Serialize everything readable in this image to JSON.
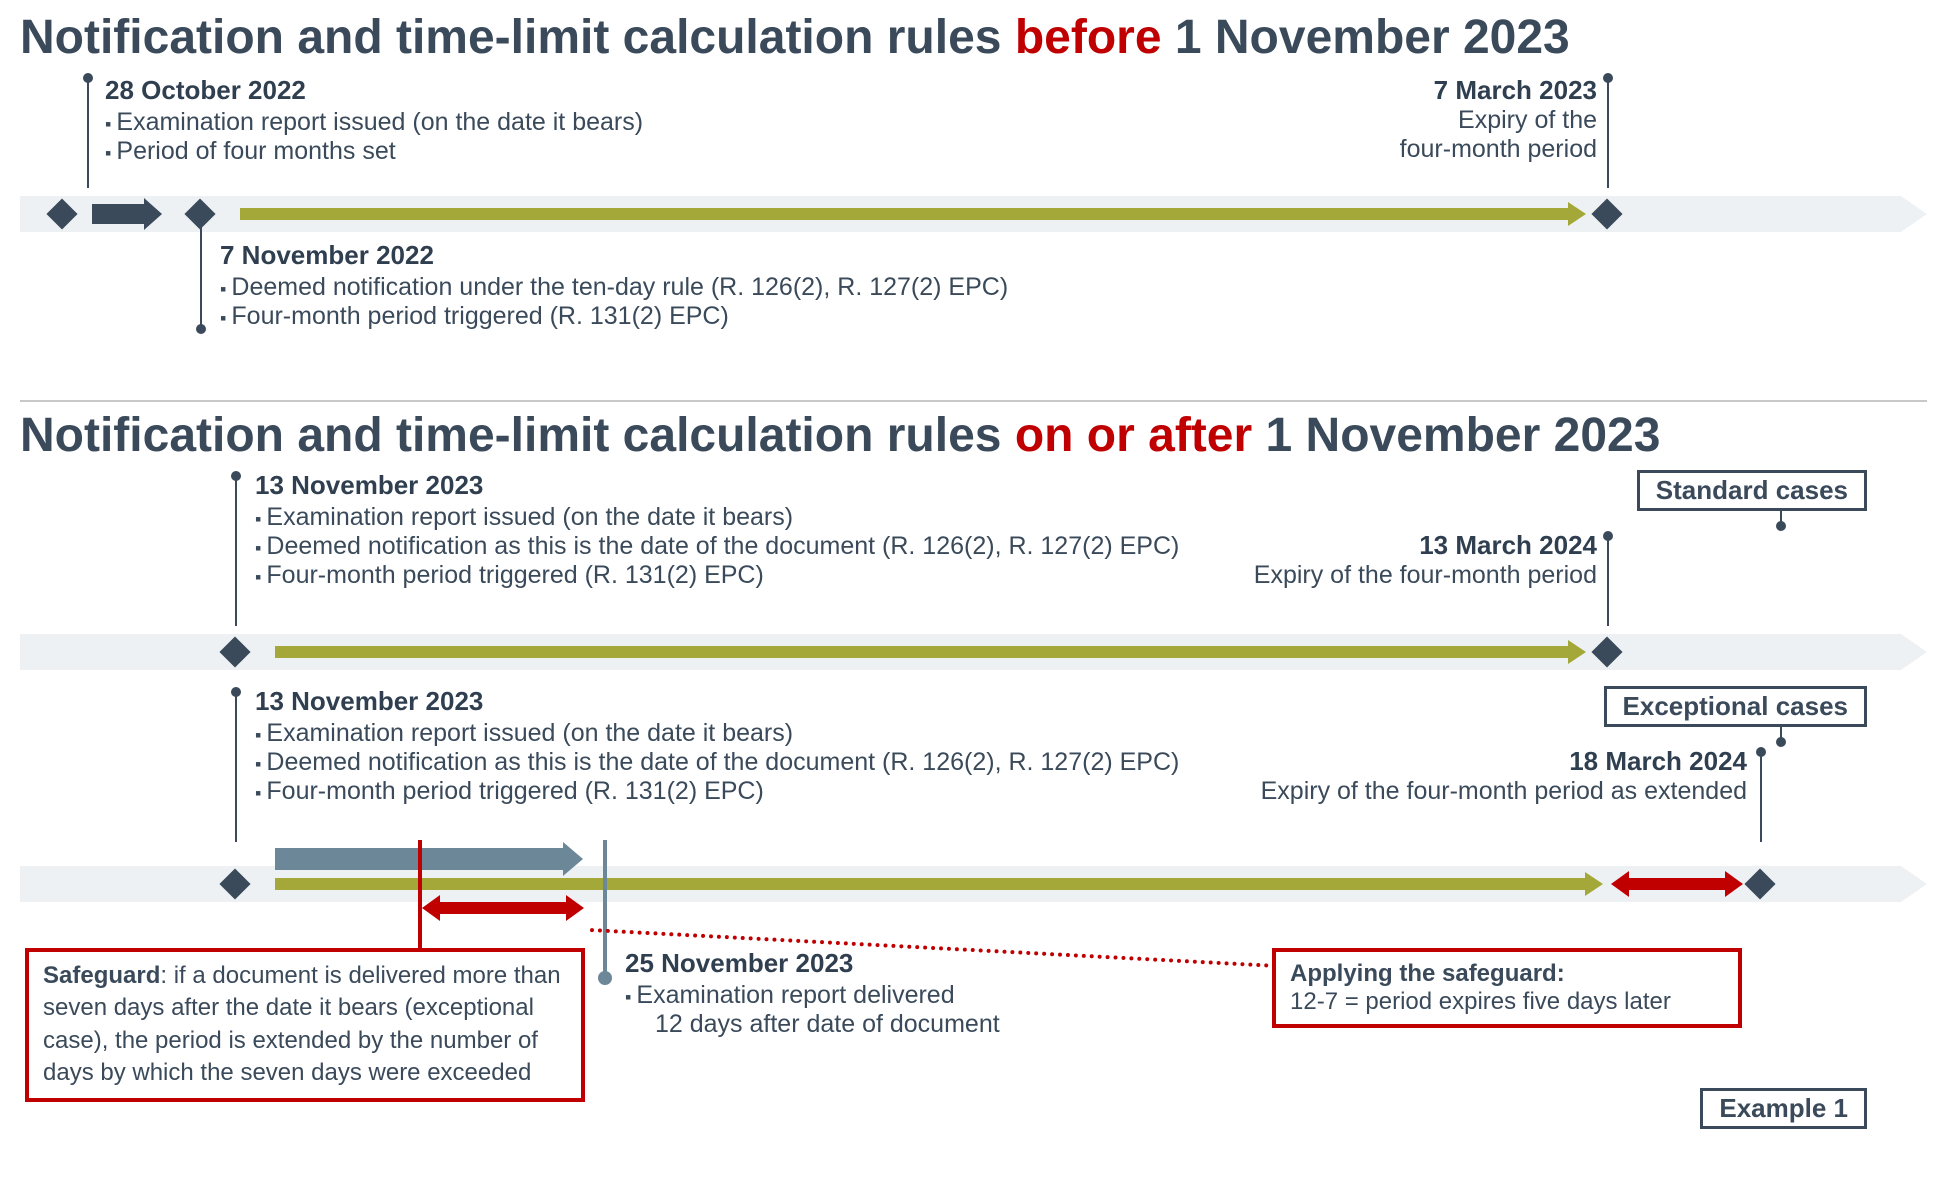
{
  "titles": {
    "before_pre": "Notification and time-limit calculation rules ",
    "before_emph": "before",
    "before_post": " 1 November 2023",
    "after_pre": "Notification and time-limit calculation rules ",
    "after_emph": "on or after",
    "after_post": " 1 November 2023"
  },
  "before": {
    "issue": {
      "date": "28 October 2022",
      "b1": "Examination report issued (on the date it bears)",
      "b2": "Period of four months set"
    },
    "deemed": {
      "date": "7 November 2022",
      "b1": "Deemed notification under the ten-day rule (R. 126(2), R. 127(2) EPC)",
      "b2": "Four-month period triggered (R. 131(2) EPC)"
    },
    "expiry": {
      "date": "7 March 2023",
      "sub": "Expiry of the\nfour-month period"
    }
  },
  "after": {
    "standard_label": "Standard cases",
    "exceptional_label": "Exceptional cases",
    "standard": {
      "date": "13 November 2023",
      "b1": "Examination report issued (on the date it bears)",
      "b2": "Deemed notification as this is the date of the document (R. 126(2), R. 127(2) EPC)",
      "b3": "Four-month period triggered (R. 131(2) EPC)",
      "expiry_date": "13 March 2024",
      "expiry_sub": "Expiry of the four-month period"
    },
    "exceptional": {
      "date": "13 November 2023",
      "b1": "Examination report issued (on the date it bears)",
      "b2": "Deemed notification as this is the date of the document (R. 126(2), R. 127(2) EPC)",
      "b3": "Four-month period triggered (R. 131(2) EPC)",
      "expiry_date": "18 March 2024",
      "expiry_sub": "Expiry of the four-month period as extended",
      "delivered_date": "25 November 2023",
      "delivered_b1": "Examination report delivered",
      "delivered_b2": "12 days after date of document"
    },
    "safeguard": {
      "label": "Safeguard",
      "text": ": if a document is delivered more than seven days after the date it bears (exceptional case), the period is extended by the number of days by which the seven days were exceeded"
    },
    "applying": {
      "label": "Applying the safeguard:",
      "text": "12-7 = period expires five days later"
    },
    "example": "Example 1"
  }
}
